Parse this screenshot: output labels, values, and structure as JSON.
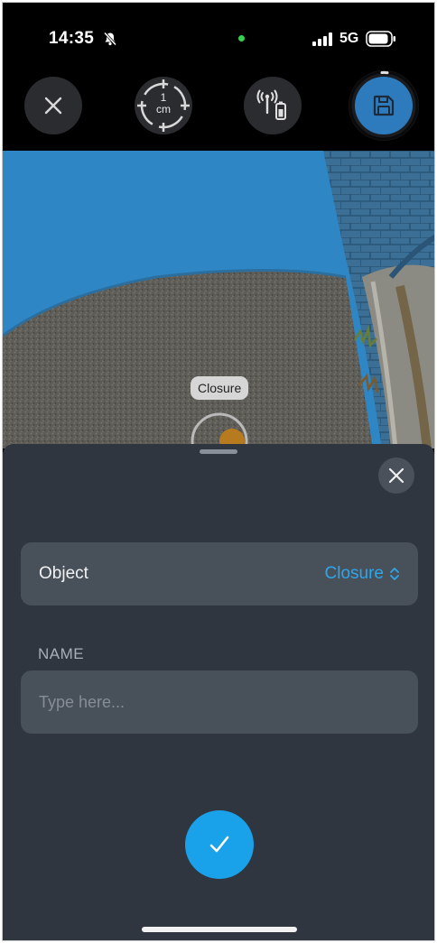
{
  "status_bar": {
    "time": "14:35",
    "network": "5G",
    "mute_icon": "bell-slash-icon",
    "recording_indicator_color": "#36d14a"
  },
  "toolbar": {
    "close_icon": "close-icon",
    "precision_value": "1",
    "precision_unit": "cm",
    "antenna_icon": "antenna-device-icon",
    "save_icon": "floppy-disk-icon",
    "save_color": "#2d7bbd"
  },
  "camera": {
    "tag_label": "Closure"
  },
  "sheet": {
    "object_label": "Object",
    "object_value": "Closure",
    "name_label": "NAME",
    "name_placeholder": "Type here...",
    "name_value": "",
    "accent_color": "#19a1ea"
  }
}
